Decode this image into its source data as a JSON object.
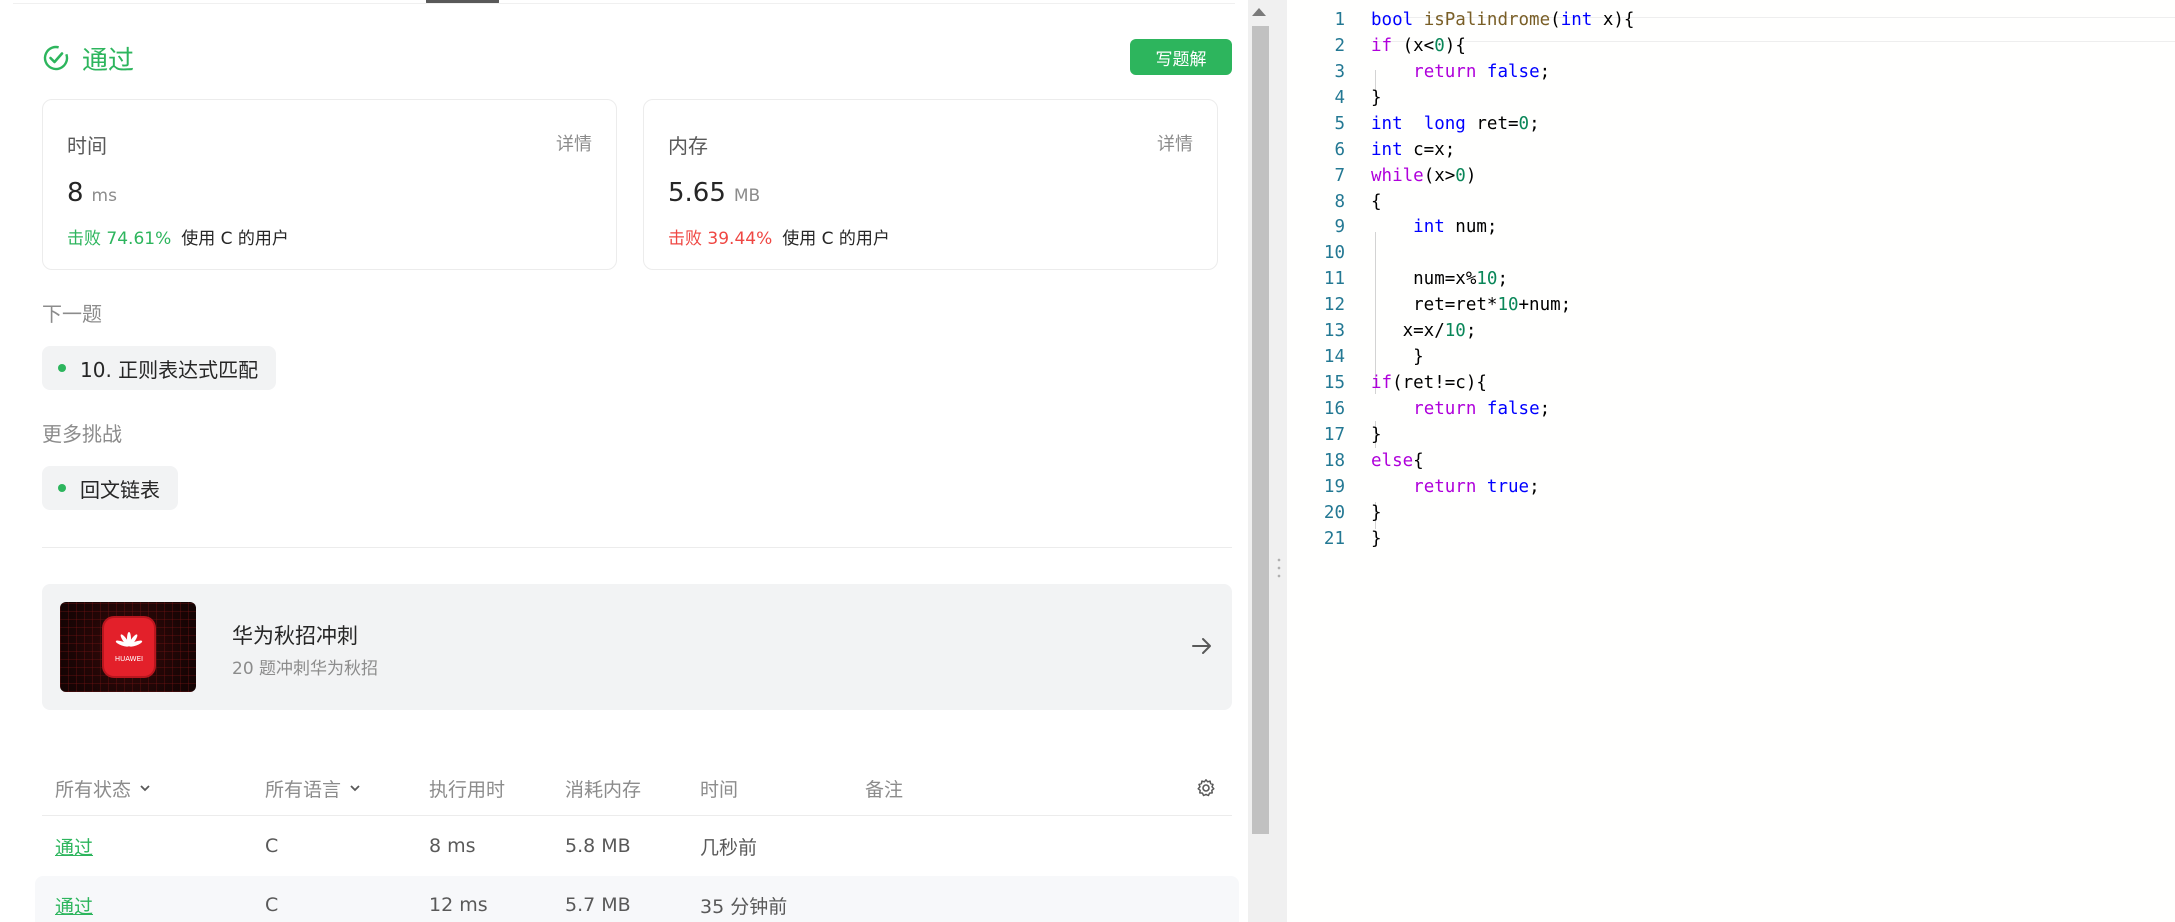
{
  "result": {
    "status": "通过",
    "write_solution": "写题解"
  },
  "stats": {
    "time": {
      "label": "时间",
      "detail": "详情",
      "value": "8",
      "unit": "ms",
      "beat": "击败 74.61%",
      "suffix": "使用 C 的用户"
    },
    "memory": {
      "label": "内存",
      "detail": "详情",
      "value": "5.65",
      "unit": "MB",
      "beat": "击败 39.44%",
      "suffix": "使用 C 的用户"
    }
  },
  "next": {
    "title": "下一题",
    "item": "10. 正则表达式匹配"
  },
  "more": {
    "title": "更多挑战",
    "item": "回文链表"
  },
  "promo": {
    "title": "华为秋招冲刺",
    "subtitle": "20 题冲刺华为秋招",
    "logo_text": "HUAWEI"
  },
  "table": {
    "headers": [
      "所有状态",
      "所有语言",
      "执行用时",
      "消耗内存",
      "时间",
      "备注"
    ],
    "rows": [
      {
        "status": "通过",
        "lang": "C",
        "runtime": "8 ms",
        "memory": "5.8 MB",
        "time": "几秒前"
      },
      {
        "status": "通过",
        "lang": "C",
        "runtime": "12 ms",
        "memory": "5.7 MB",
        "time": "35 分钟前"
      }
    ]
  },
  "colors": {
    "accent_green": "#2db55d",
    "danger_red": "#ef4743"
  },
  "editor": {
    "line_numbers": [
      "1",
      "2",
      "3",
      "4",
      "5",
      "6",
      "7",
      "8",
      "9",
      "10",
      "11",
      "12",
      "13",
      "14",
      "15",
      "16",
      "17",
      "18",
      "19",
      "20",
      "21"
    ],
    "code": [
      "bool isPalindrome(int x){",
      "if (x<0){",
      "    return false;",
      "}",
      "int  long ret=0;",
      "int c=x;",
      "while(x>0)",
      "{",
      "    int num;",
      "",
      "    num=x%10;",
      "    ret=ret*10+num;",
      "   x=x/10;",
      "    }",
      "if(ret!=c){",
      "    return false;",
      "}",
      "else{",
      "    return true;",
      "}",
      "}"
    ]
  }
}
